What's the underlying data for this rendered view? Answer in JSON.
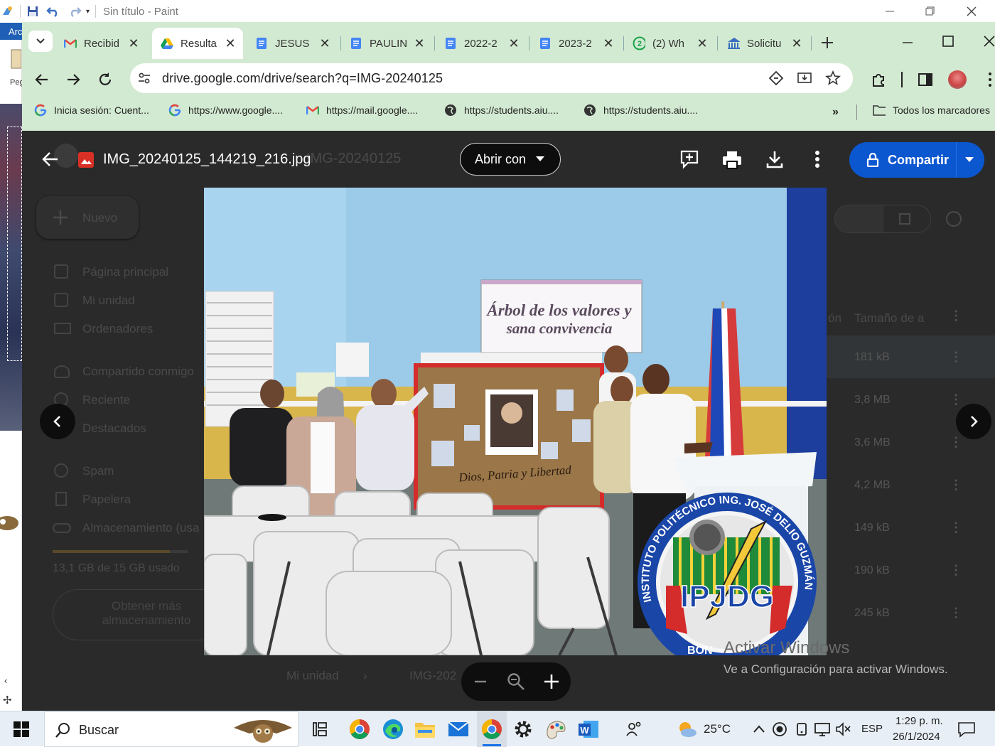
{
  "paint": {
    "title": "Sin título - Paint",
    "tab_label": "Arc",
    "tool_label": "Peg"
  },
  "chrome": {
    "tabs": [
      {
        "label": "Recibid",
        "icon": "gmail-icon"
      },
      {
        "label": "Resulta",
        "icon": "drive-icon",
        "active": true
      },
      {
        "label": "JESUS",
        "icon": "docs-icon"
      },
      {
        "label": "PAULIN",
        "icon": "docs-icon"
      },
      {
        "label": "2022-2",
        "icon": "docs-icon"
      },
      {
        "label": "2023-2",
        "icon": "docs-icon"
      },
      {
        "label": "(2) Wh",
        "icon": "whatsapp-icon"
      },
      {
        "label": "Solicitu",
        "icon": "institution-icon"
      }
    ],
    "url": "drive.google.com/drive/search?q=IMG-20240125",
    "bookmarks": [
      {
        "label": "Inicia sesión: Cuent...",
        "icon": "google-icon"
      },
      {
        "label": "https://www.google....",
        "icon": "google-icon"
      },
      {
        "label": "https://mail.google....",
        "icon": "gmail-icon"
      },
      {
        "label": "https://students.aiu....",
        "icon": "globe-icon"
      },
      {
        "label": "https://students.aiu....",
        "icon": "globe-icon"
      }
    ],
    "all_bookmarks": "Todos los marcadores"
  },
  "viewer": {
    "filename": "IMG_20240125_144219_216.jpg",
    "open_with": "Abrir con",
    "share": "Compartir",
    "watermark_title": "Activar Windows",
    "watermark_sub": "Ve a Configuración para activar Windows."
  },
  "drive_bg": {
    "search_ghost": "IMG-20240125",
    "new_button": "Nuevo",
    "nav": [
      "Página principal",
      "Mi unidad",
      "Ordenadores",
      "Compartido conmigo",
      "Reciente",
      "Destacados",
      "Spam",
      "Papelera",
      "Almacenamiento (usa"
    ],
    "storage_text": "13,1 GB de 15 GB usado",
    "storage_used_fraction": 0.87,
    "get_more": [
      "Obtener más",
      "almacenamiento"
    ],
    "col_modified": "ón",
    "col_size": "Tamaño de a",
    "sizes": [
      "181 kB",
      "3,8 MB",
      "3,6 MB",
      "4,2 MB",
      "149 kB",
      "190 kB",
      "245 kB"
    ],
    "breadcrumb": [
      "Mi unidad",
      "IMG-202"
    ]
  },
  "photo": {
    "banner_line1": "Árbol de los valores y",
    "banner_line2": "sana convivencia",
    "board_caption": "Dios, Patria y Libertad",
    "logo_top": "INSTITUTO POLITÉCNICO ING. JOSÉ DELIO GUZMÁN",
    "logo_center": "IPJDG",
    "logo_bottom": "BON"
  },
  "taskbar": {
    "search": "Buscar",
    "weather": "25°C",
    "lang": "ESP",
    "time": "1:29 p. m.",
    "date": "26/1/2024"
  }
}
